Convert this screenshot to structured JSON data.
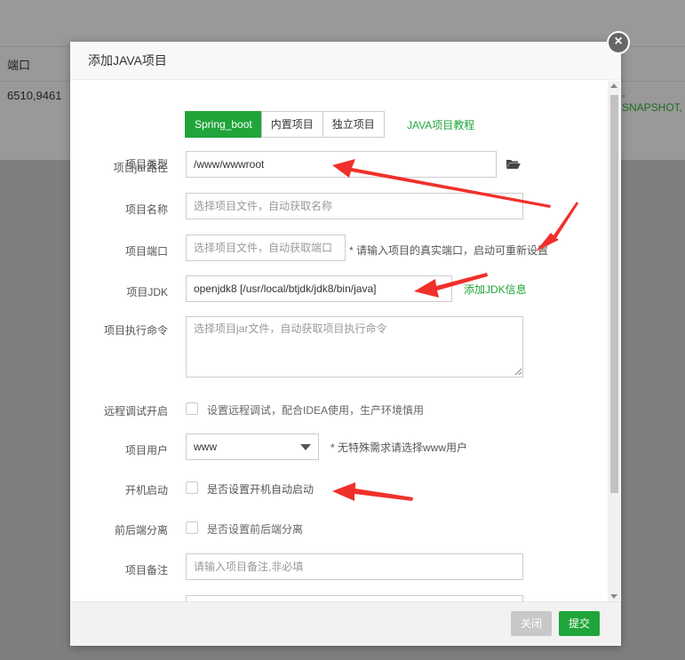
{
  "background": {
    "col_header": "端口",
    "row_value": "6510,9461",
    "row_tail": "-SNAPSHOT,"
  },
  "dialog": {
    "title": "添加JAVA项目",
    "close_symbol": "×"
  },
  "form": {
    "type": {
      "label": "项目类型",
      "options": [
        "Spring_boot",
        "内置项目",
        "独立项目"
      ],
      "selected": "Spring_boot",
      "tutorial_link": "JAVA项目教程"
    },
    "jar_path": {
      "label": "项目jar路径",
      "value": "/www/wwwroot"
    },
    "name": {
      "label": "项目名称",
      "placeholder": "选择项目文件，自动获取名称"
    },
    "port": {
      "label": "项目端口",
      "placeholder": "选择项目文件，自动获取端口",
      "hint": "* 请输入项目的真实端口，启动可重新设置"
    },
    "jdk": {
      "label": "项目JDK",
      "value": "openjdk8 [/usr/local/btjdk/jdk8/bin/java]",
      "add_link": "添加JDK信息"
    },
    "command": {
      "label": "项目执行命令",
      "placeholder": "选择项目jar文件，自动获取项目执行命令"
    },
    "remote_debug": {
      "label": "远程调试开启",
      "text": "设置远程调试，配合IDEA使用，生产环境慎用"
    },
    "user": {
      "label": "项目用户",
      "value": "www",
      "hint": "* 无特殊需求请选择www用户"
    },
    "autostart": {
      "label": "开机启动",
      "text": "是否设置开机自动启动"
    },
    "separation": {
      "label": "前后端分离",
      "text": "是否设置前后端分离"
    },
    "remark": {
      "label": "项目备注",
      "placeholder": "请输入项目备注,非必填"
    }
  },
  "footer": {
    "close_label": "关闭",
    "submit_label": "提交"
  },
  "colors": {
    "accent_green": "#20a53a",
    "annotation_red": "#f0302a"
  }
}
